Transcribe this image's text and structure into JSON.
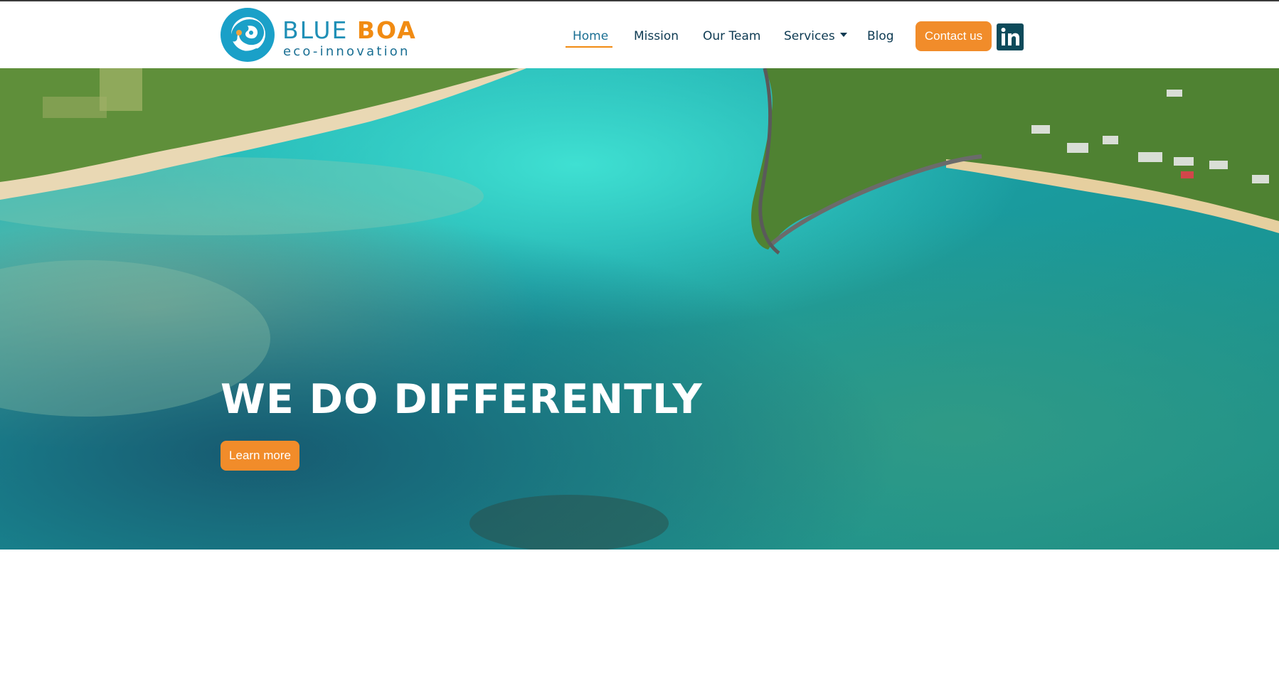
{
  "brand": {
    "name_part1": "BLUE",
    "name_part2": "BOA",
    "tagline": "eco-innovation",
    "logo_icon": "snake-logo-icon"
  },
  "nav": {
    "items": [
      {
        "label": "Home",
        "active": true
      },
      {
        "label": "Mission",
        "active": false
      },
      {
        "label": "Our Team",
        "active": false
      },
      {
        "label": "Services",
        "active": false,
        "dropdown": true
      },
      {
        "label": "Blog",
        "active": false
      }
    ],
    "contact_label": "Contact us",
    "social_icon": "linkedin-icon"
  },
  "hero": {
    "title": "WE DO DIFFERENTLY",
    "cta_label": "Learn more",
    "background": "aerial-lagoon-image"
  },
  "colors": {
    "accent_orange": "#f18c2a",
    "brand_blue": "#1f8fb6",
    "nav_text": "#0d3a52",
    "linkedin_bg": "#0d4a5a"
  }
}
